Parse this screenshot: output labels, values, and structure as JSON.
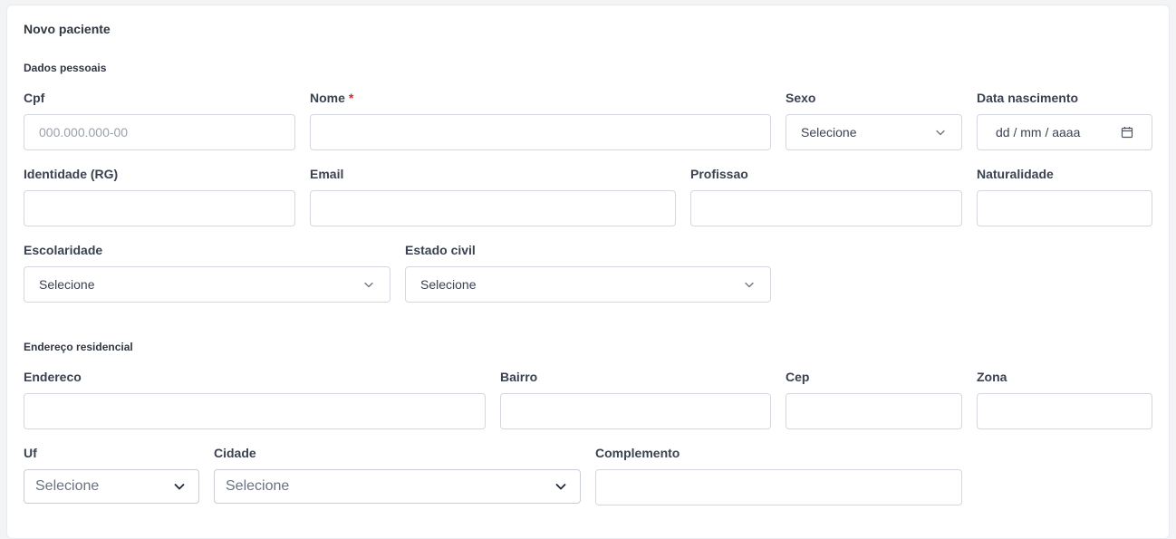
{
  "form": {
    "title": "Novo paciente",
    "personal": {
      "section_title": "Dados pessoais",
      "cpf_label": "Cpf",
      "cpf_placeholder": "000.000.000-00",
      "nome_label": "Nome",
      "nome_required": "*",
      "sexo_label": "Sexo",
      "sexo_value": "Selecione",
      "nascimento_label": "Data nascimento",
      "nascimento_placeholder": "dd / mm / aaaa",
      "rg_label": "Identidade (RG)",
      "email_label": "Email",
      "profissao_label": "Profissao",
      "naturalidade_label": "Naturalidade",
      "escolaridade_label": "Escolaridade",
      "escolaridade_value": "Selecione",
      "estado_civil_label": "Estado civil",
      "estado_civil_value": "Selecione"
    },
    "address": {
      "section_title": "Endereço residencial",
      "endereco_label": "Endereco",
      "bairro_label": "Bairro",
      "cep_label": "Cep",
      "zona_label": "Zona",
      "uf_label": "Uf",
      "uf_value": "Selecione",
      "cidade_label": "Cidade",
      "cidade_value": "Selecione",
      "complemento_label": "Complemento"
    }
  },
  "icons": {
    "select": "chevron-down-icon",
    "date": "calendar-icon"
  },
  "colors": {
    "required": "#dc2626",
    "border": "#d4d8de",
    "background": "#f3f4f6"
  }
}
